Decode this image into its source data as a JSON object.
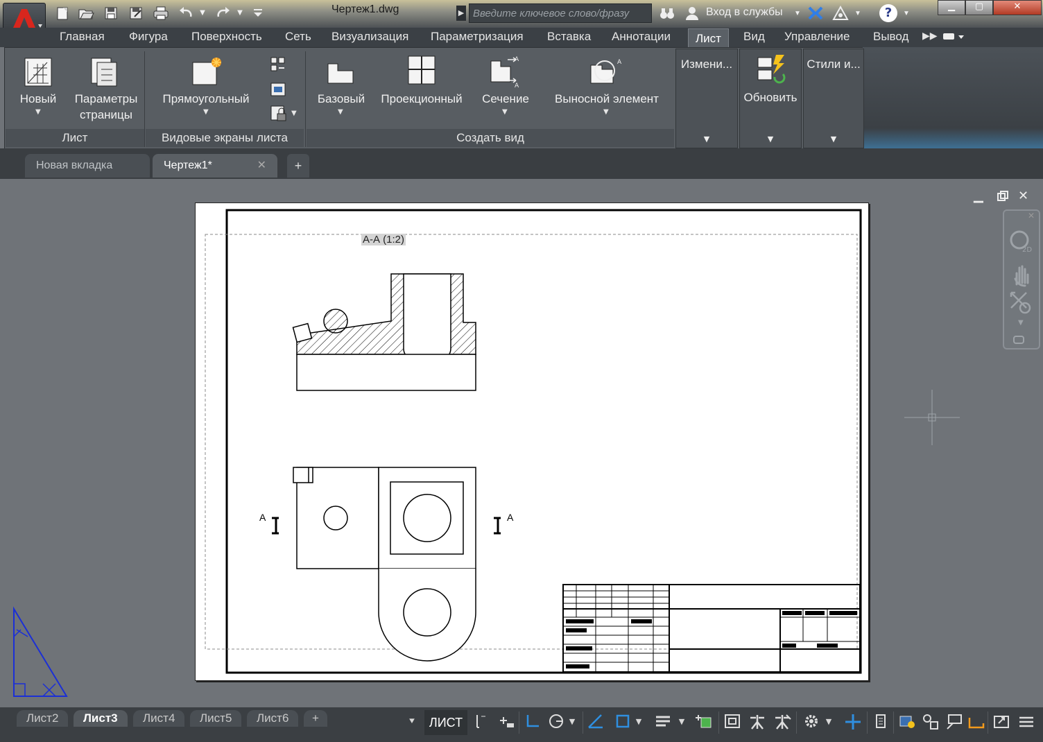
{
  "titlebar": {
    "filename": "Чертеж1.dwg",
    "search_placeholder": "Введите ключевое слово/фразу",
    "signin": "Вход в службы",
    "help": "?"
  },
  "ribbon_tabs": [
    "Главная",
    "Фигура",
    "Поверхность",
    "Сеть",
    "Визуализация",
    "Параметризация",
    "Вставка",
    "Аннотации",
    "Лист",
    "Вид",
    "Управление",
    "Вывод"
  ],
  "ribbon_active_tab": "Лист",
  "ribbon": {
    "new": "Новый",
    "page_setup_1": "Параметры",
    "page_setup_2": "страницы",
    "rectangular": "Прямоугольный",
    "base": "Базовый",
    "projected": "Проекционный",
    "section": "Сечение",
    "detail": "Выносной элемент",
    "modify": "Измени...",
    "update": "Обновить",
    "styles": "Стили и...",
    "panel_layout": "Лист",
    "panel_viewports": "Видовые экраны листа",
    "panel_create_view": "Создать вид"
  },
  "doc_tabs": {
    "new_tab": "Новая вкладка",
    "drawing": "Чертеж1*"
  },
  "drawing": {
    "section_label": "А-А (1:2)",
    "cut_letter_left": "А",
    "cut_letter_right": "А"
  },
  "layout_tabs": [
    "Лист2",
    "Лист3",
    "Лист4",
    "Лист5",
    "Лист6"
  ],
  "layout_active": "Лист3",
  "status": {
    "space": "ЛИСТ"
  },
  "colors": {
    "ucs_icon": "#1b2fd6",
    "accent_blue": "#2f8fe0"
  }
}
